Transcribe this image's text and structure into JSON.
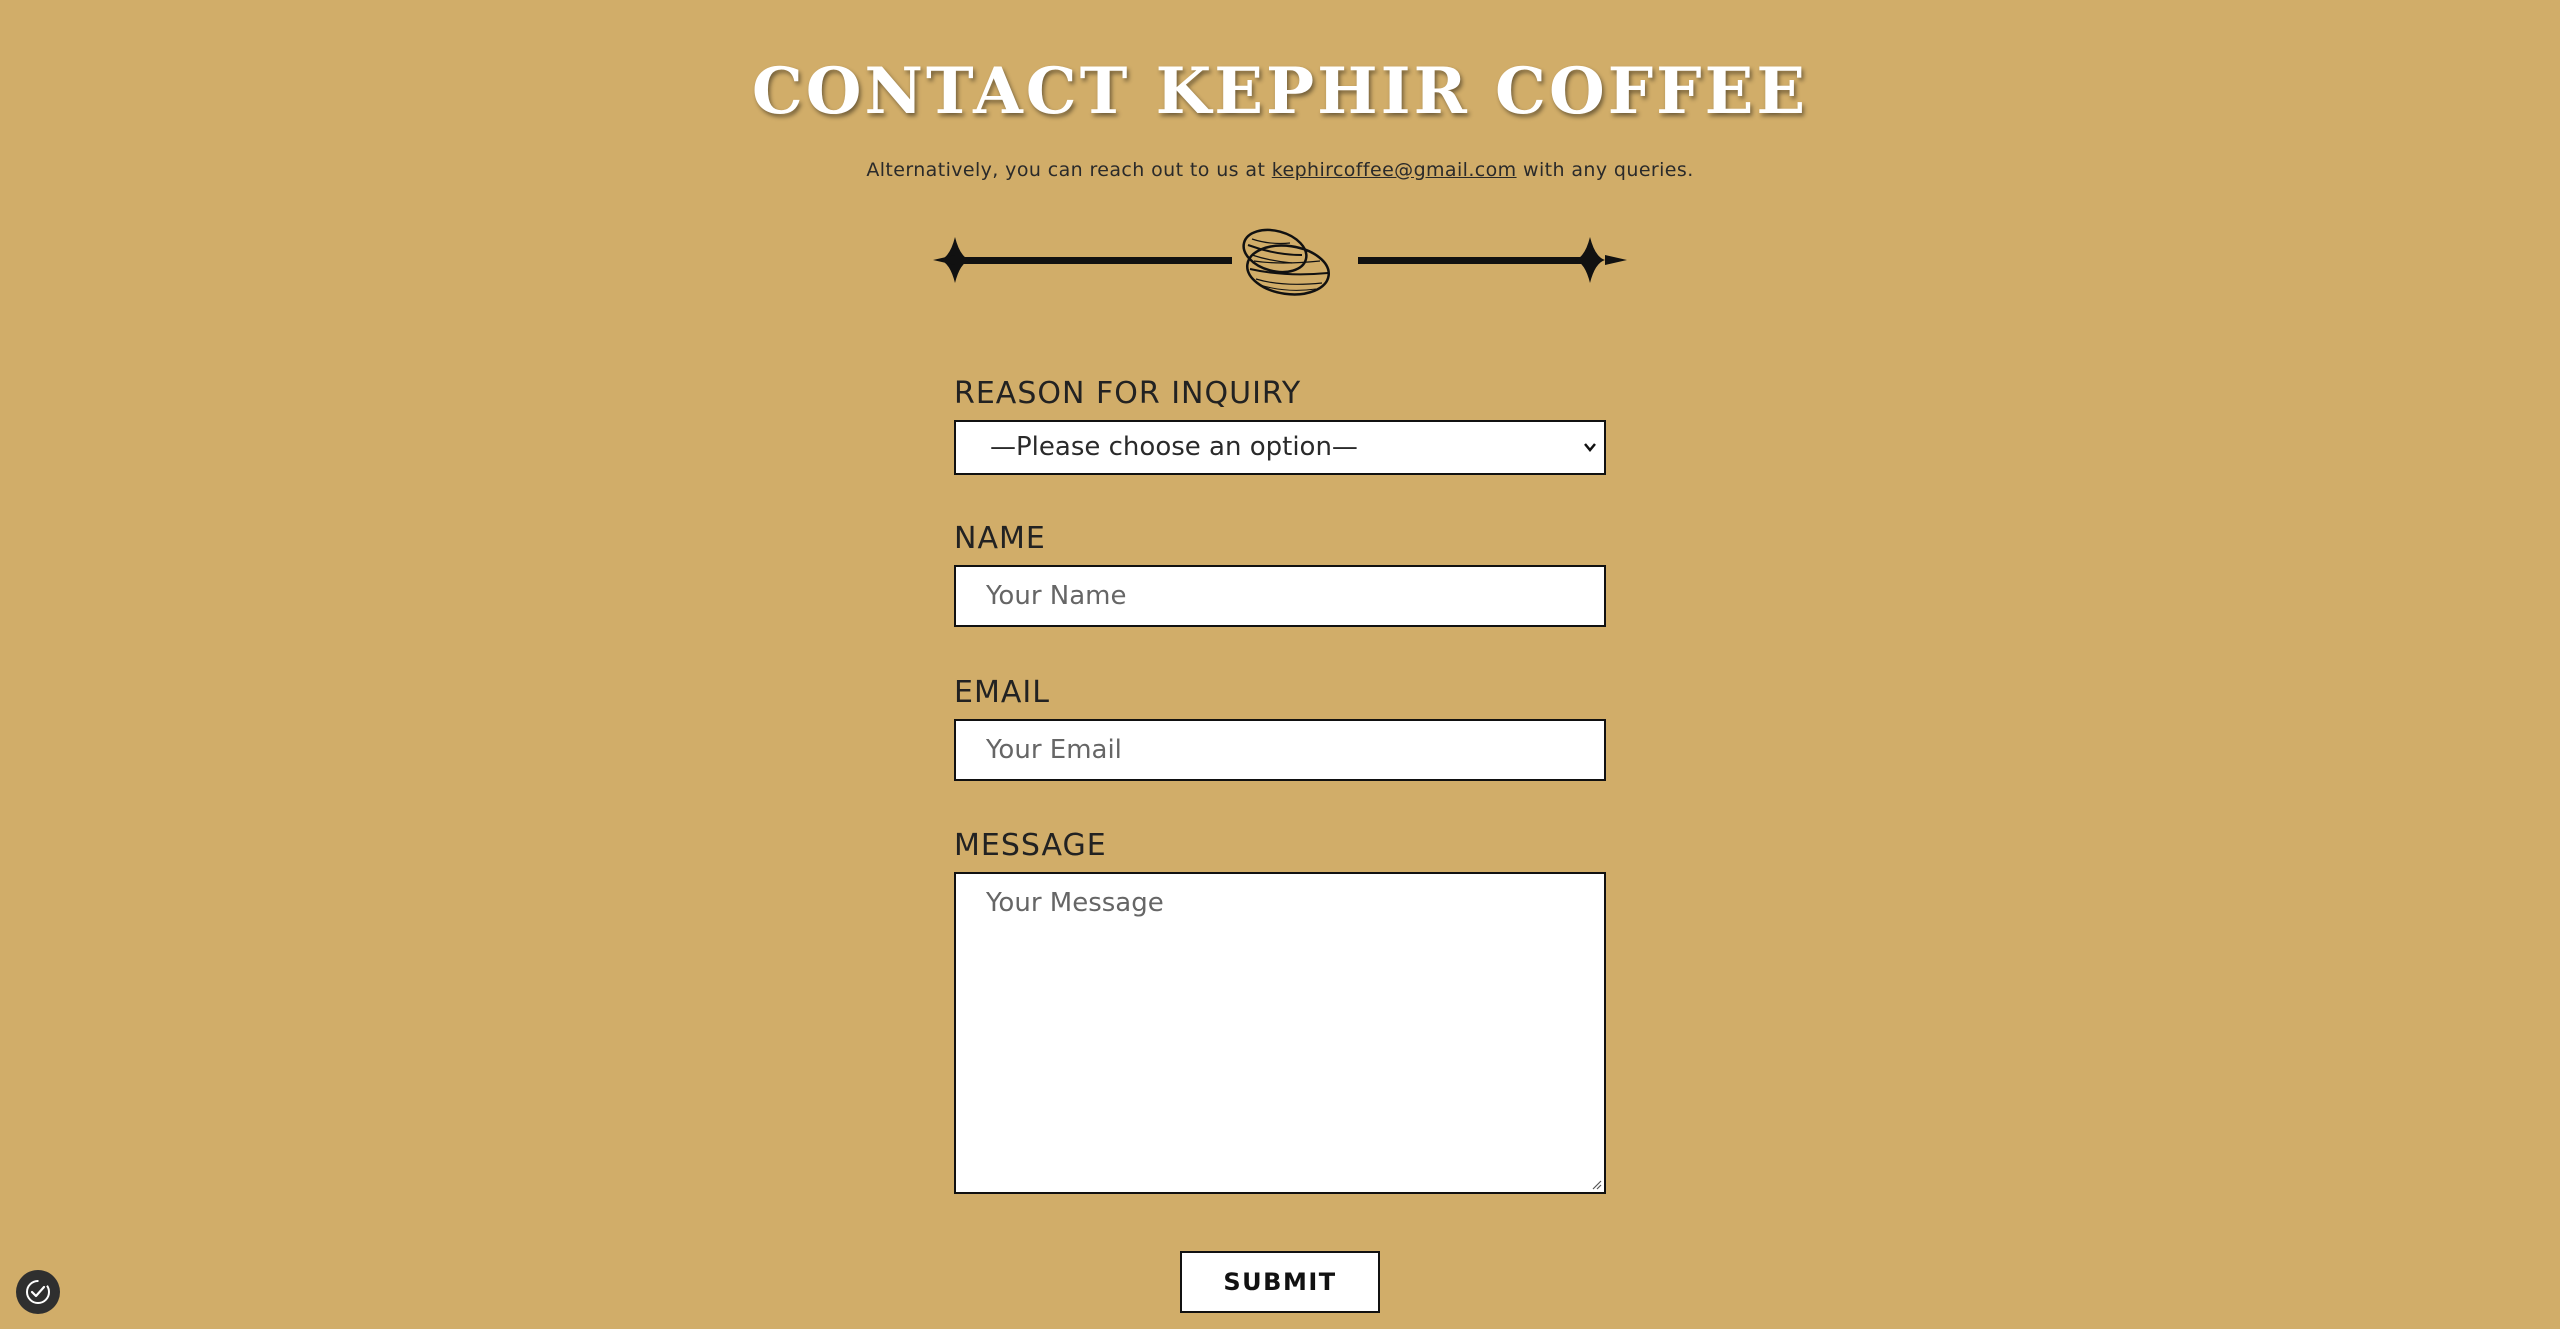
{
  "header": {
    "title": "CONTACT KEPHIR COFFEE",
    "subtitle_prefix": "Alternatively, you can reach out to us at ",
    "email": "kephircoffee@gmail.com",
    "subtitle_suffix": " with any queries."
  },
  "divider": {
    "icon": "coffee-beans-icon"
  },
  "form": {
    "reason": {
      "label": "REASON FOR INQUIRY",
      "selected": "—Please choose an option—"
    },
    "name": {
      "label": "NAME",
      "placeholder": "Your Name"
    },
    "email": {
      "label": "EMAIL",
      "placeholder": "Your Email"
    },
    "message": {
      "label": "MESSAGE",
      "placeholder": "Your Message"
    },
    "submit_label": "SUBMIT"
  },
  "widgets": {
    "privacy_icon": "privacy-settings-icon"
  },
  "colors": {
    "background": "#d1ad69",
    "field_background": "#ffffff",
    "border": "#111111",
    "title": "#ffffff"
  }
}
